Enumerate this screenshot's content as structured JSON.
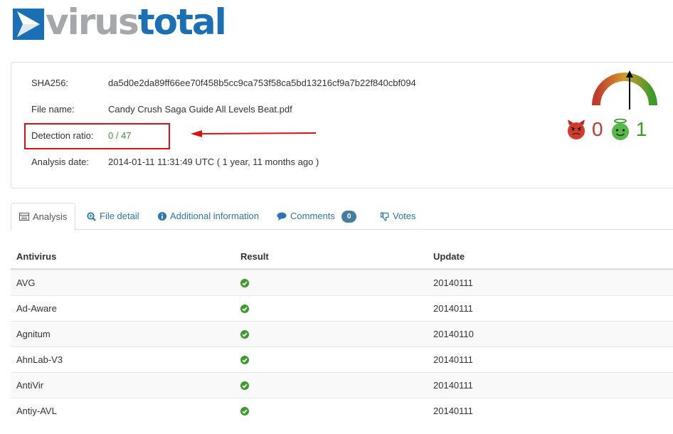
{
  "brand": {
    "word1": "virus",
    "word2": "total"
  },
  "summary": {
    "sha_label": "SHA256:",
    "sha_value": "da5d0e2da89ff66ee70f458b5cc9ca753f58ca5bd13216cf9a7b22f840cbf094",
    "file_label": "File name:",
    "file_value": "Candy Crush Saga Guide All Levels Beat.pdf",
    "ratio_label": "Detection ratio:",
    "ratio_value": "0 / 47",
    "date_label": "Analysis date:",
    "date_value": "2014-01-11 11:31:49 UTC ( 1 year, 11 months ago )"
  },
  "community": {
    "malicious_votes": "0",
    "harmless_votes": "1"
  },
  "tabs": [
    {
      "label": "Analysis",
      "icon": "table-icon"
    },
    {
      "label": "File detail",
      "icon": "zoom-icon"
    },
    {
      "label": "Additional information",
      "icon": "info-icon"
    },
    {
      "label": "Comments",
      "icon": "comment-icon",
      "count": "0"
    },
    {
      "label": "Votes",
      "icon": "thumbs-down-icon"
    }
  ],
  "table": {
    "headers": [
      "Antivirus",
      "Result",
      "Update"
    ],
    "rows": [
      {
        "av": "AVG",
        "result": "clean-check-icon",
        "update": "20140111"
      },
      {
        "av": "Ad-Aware",
        "result": "clean-check-icon",
        "update": "20140111"
      },
      {
        "av": "Agnitum",
        "result": "clean-check-icon",
        "update": "20140110"
      },
      {
        "av": "AhnLab-V3",
        "result": "clean-check-icon",
        "update": "20140111"
      },
      {
        "av": "AntiVir",
        "result": "clean-check-icon",
        "update": "20140111"
      },
      {
        "av": "Antiy-AVL",
        "result": "clean-check-icon",
        "update": "20140111"
      }
    ]
  },
  "colors": {
    "brand_blue": "#1b6fb5",
    "link": "#2a76b8",
    "clean": "#3a9a2a",
    "malicious": "#c0392b",
    "highlight": "#e01010"
  }
}
